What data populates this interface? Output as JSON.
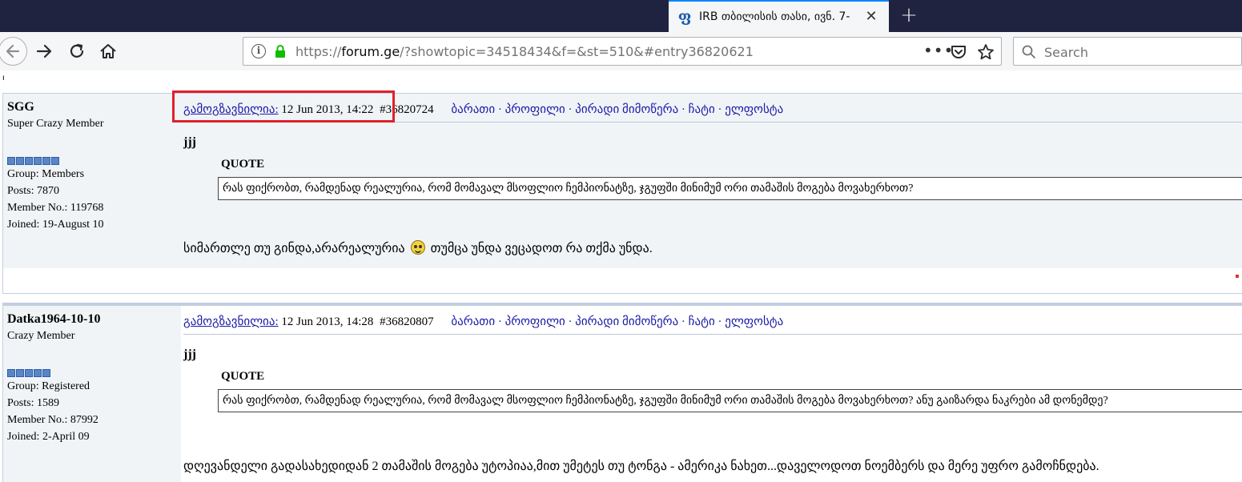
{
  "browser": {
    "tab": {
      "title": "IRB თბილისის თასი, ივნ. 7-",
      "favicon_glyph": "ფ"
    },
    "new_tab_glyph": "+",
    "close_glyph": "✕",
    "url": {
      "prefix": "https://",
      "domain": "forum.ge",
      "path": "/?showtopic=34518434&f=&st=510&#entry36820621"
    },
    "url_more": "•••",
    "search_placeholder": "Search"
  },
  "page": {
    "stray_char": "ᑊ",
    "posts": [
      {
        "author": "SGG",
        "rank": "Super Crazy Member",
        "pips": 6,
        "group": "Group: Members",
        "posts": "Posts: 7870",
        "member_no": "Member No.: 119768",
        "joined": "Joined: 19-August 10",
        "sent_label": "გამოგზავნილია:",
        "date": "12 Jun 2013, 14:22",
        "entry": "#36820724",
        "actions": "ბარათი · პროფილი · პირადი მიმოწერა · ჩატი · ელფოსტა",
        "subject": "jjj",
        "quote_title": "QUOTE",
        "quote_text": "რას ფიქრობთ, რამდენად რეალურია, რომ მომავალ მსოფლიო ჩემპიონატზე, ჯგუფში მინიმუმ ორი თამაშის მოგება მოვახერხოთ?",
        "text_before": "სიმართლე თუ გინდა,არარეალურია",
        "text_after": "თუმცა უნდა ვეცადოთ რა თქმა უნდა."
      },
      {
        "author": "Datka1964-10-10",
        "rank": "Crazy Member",
        "pips": 5,
        "group": "Group: Registered",
        "posts": "Posts: 1589",
        "member_no": "Member No.: 87992",
        "joined": "Joined: 2-April 09",
        "sent_label": "გამოგზავნილია:",
        "date": "12 Jun 2013, 14:28",
        "entry": "#36820807",
        "actions": "ბარათი · პროფილი · პირადი მიმოწერა · ჩატი · ელფოსტა",
        "subject": "jjj",
        "quote_title": "QUOTE",
        "quote_text": "რას ფიქრობთ, რამდენად რეალურია, რომ მომავალ მსოფლიო ჩემპიონატზე, ჯგუფში მინიმუმ ორი თამაშის მოგება მოვახერხოთ? ანუ გაიზარდა ნაკრები ამ დონემდე?",
        "text": "დღევანდელი გადასახედიდან 2 თამაშის მოგება უტოპიაა,მით უმეტეს თუ ტონგა - ამერიკა ნახეთ...დაველოდოთ ნოემბერს და მერე უფრო გამოჩნდება."
      }
    ]
  },
  "colors": {
    "highlight": "#e0202a",
    "link": "#1a1aa8",
    "author_bg": "#f1f4f7"
  }
}
